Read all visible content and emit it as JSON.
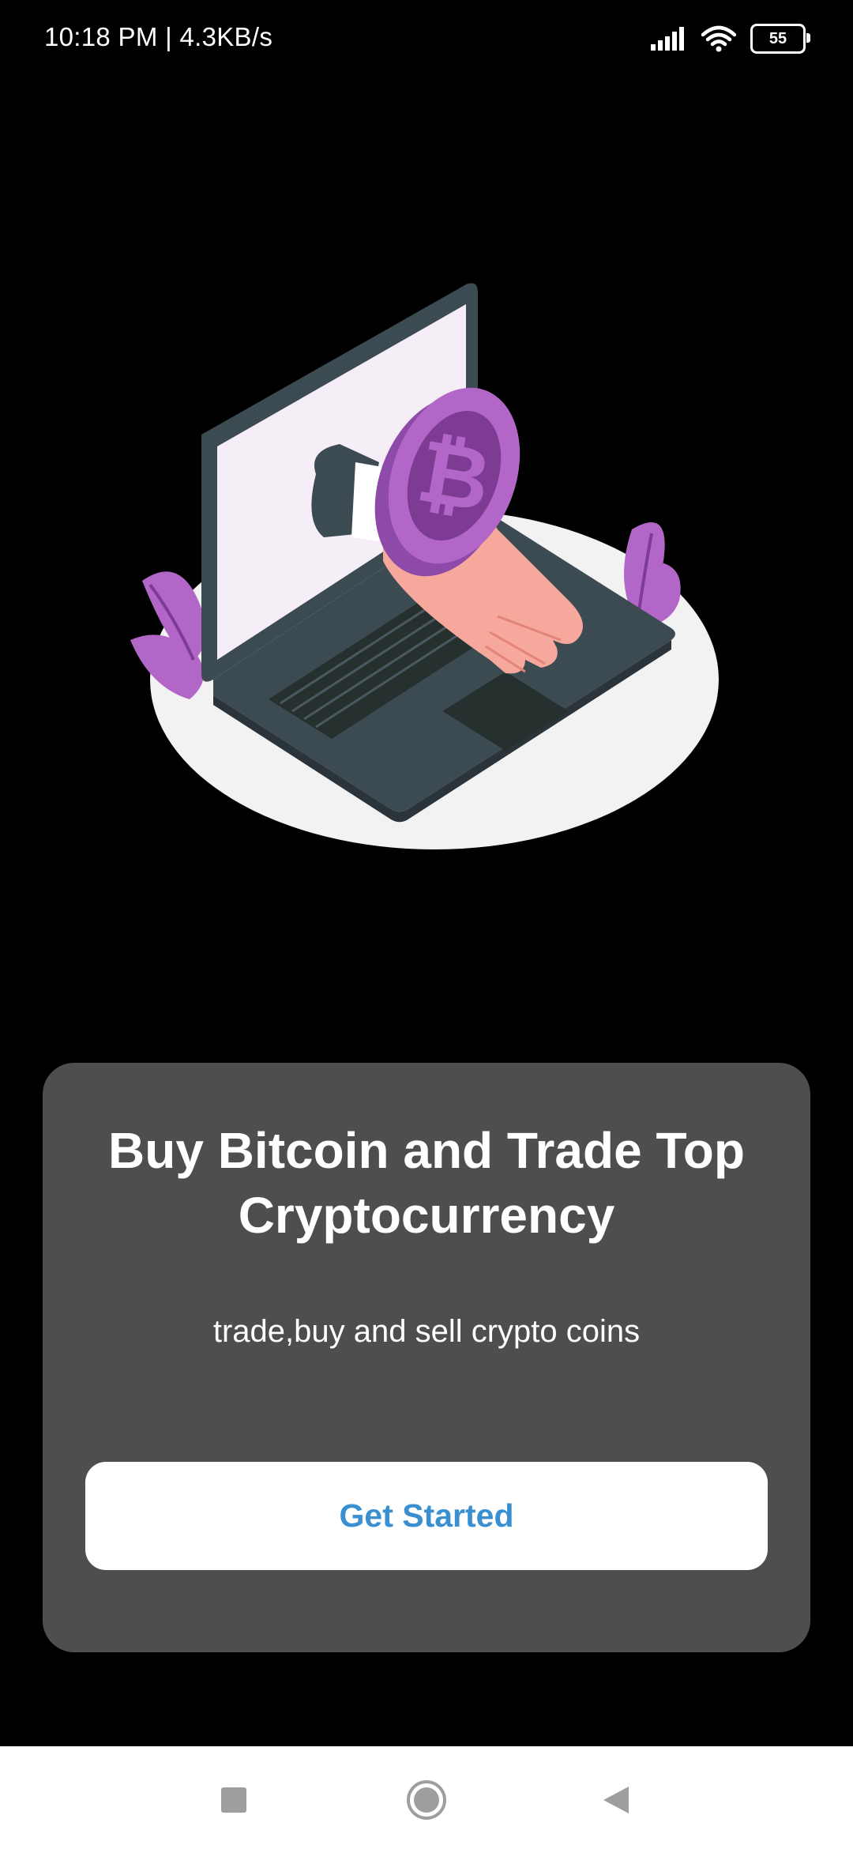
{
  "status_bar": {
    "time_speed": "10:18 PM | 4.3KB/s",
    "battery_level": "55",
    "icons": [
      "signal-icon",
      "wifi-icon",
      "battery-icon"
    ]
  },
  "illustration": {
    "description_icon": "laptop-bitcoin-illustration",
    "coin_symbol": "₿",
    "colors": {
      "purple": "#b267c8",
      "laptop": "#3c4a52",
      "screen": "#f5eef6",
      "hand": "#f6a89d",
      "base": "#f2f2f2"
    }
  },
  "card": {
    "title": "Buy Bitcoin and Trade Top Cryptocurrency",
    "subtitle": "trade,buy and sell crypto coins",
    "cta_label": "Get Started",
    "background": "#4e4e4e",
    "cta_text_color": "#3a8fd0"
  },
  "nav_bar": {
    "buttons": [
      "recents-icon",
      "home-icon",
      "back-icon"
    ]
  }
}
